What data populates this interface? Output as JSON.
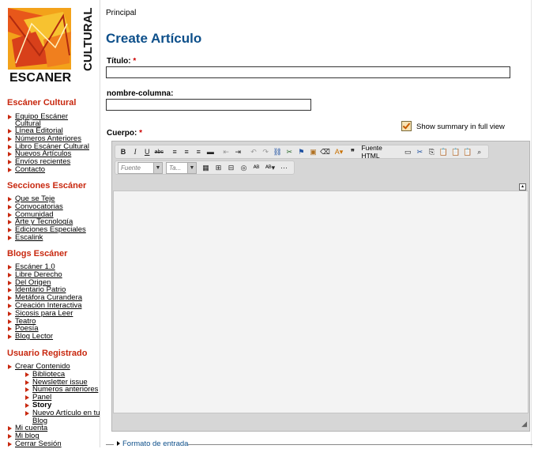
{
  "sidebar": {
    "sections": [
      {
        "title": "Escáner Cultural",
        "items": [
          "Equipo Escáner Cultural",
          "Línea Editorial",
          "Números Anteriores",
          "Libro Escáner Cultural",
          "Nuevos Artículos",
          "Envíos recientes",
          "Contacto"
        ]
      },
      {
        "title": "Secciones Escáner",
        "items": [
          "Que se Teje",
          "Convocatorias",
          "Comunidad",
          "Arte y Tecnología",
          "Ediciones Especiales",
          "Escalink"
        ]
      },
      {
        "title": "Blogs Escáner",
        "items": [
          "Escáner 1.0",
          "Libre Derecho",
          "Del Origen",
          "Identario Patrio",
          "Metáfora Curandera",
          "Creación Interactiva",
          "Sicosis para Leer",
          "Teatro",
          "Poesía",
          "Blog Lector"
        ]
      },
      {
        "title": "Usuario Registrado",
        "items": [
          "Crear Contenido",
          "Mi cuenta",
          "Mi blog",
          "Cerrar Sesión"
        ],
        "subitems": [
          "Biblioteca",
          "Newsletter issue",
          "Numeros anteriores",
          "Panel",
          "Story",
          "Nuevo Artículo en tu Blog"
        ]
      }
    ]
  },
  "breadcrumb": "Principal",
  "page_title": "Create Artículo",
  "form": {
    "title_label": "Título:",
    "title_value": "",
    "column_label": "nombre-columna:",
    "column_value": "",
    "summary_label": "Show summary in full view",
    "summary_checked": true,
    "body_label": "Cuerpo:",
    "required_mark": "*"
  },
  "editor": {
    "source_label": "Fuente HTML",
    "font_placeholder": "Fuente",
    "size_placeholder": "Ta..."
  },
  "input_format_label": "Formato de entrada",
  "colors": {
    "accent_red": "#c8280f",
    "title_blue": "#0d4f8a"
  }
}
